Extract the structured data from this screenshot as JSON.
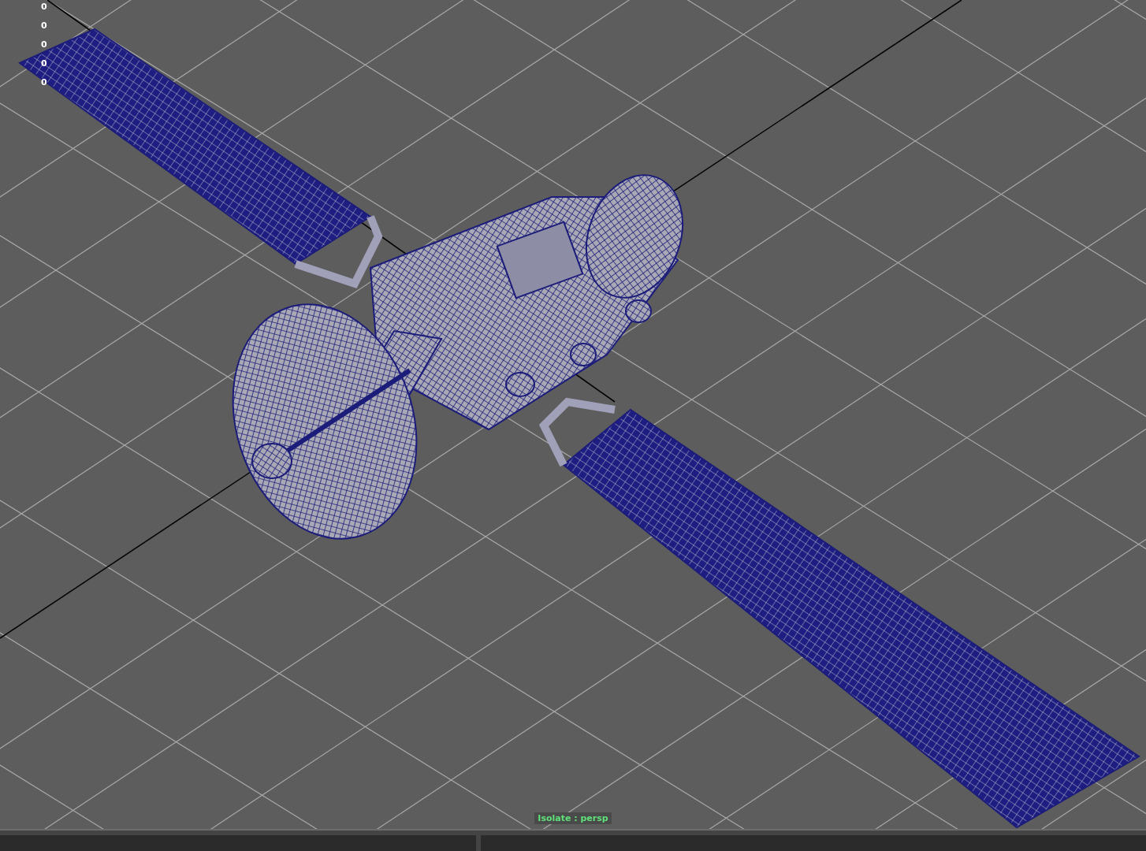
{
  "hud_values": [
    "0",
    "0",
    "0",
    "0",
    "0"
  ],
  "viewport_label": "Isolate : persp"
}
